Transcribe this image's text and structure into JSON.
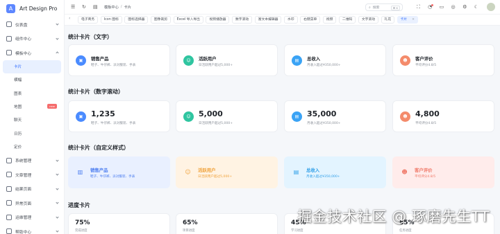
{
  "brand": {
    "name": "Art Design Pro",
    "logo_icon": "A"
  },
  "sidebar": {
    "items": [
      {
        "label": "仪表盘",
        "icon": "dashboard-icon",
        "expanded": false
      },
      {
        "label": "组件中心",
        "icon": "components-icon",
        "expanded": false
      },
      {
        "label": "模板中心",
        "icon": "template-icon",
        "expanded": true
      }
    ],
    "template_children": [
      {
        "label": "卡片",
        "active": true
      },
      {
        "label": "横幅"
      },
      {
        "label": "图表"
      },
      {
        "label": "地图",
        "badge": "new"
      },
      {
        "label": "聊天"
      },
      {
        "label": "日历"
      },
      {
        "label": "定价"
      }
    ],
    "more_items": [
      {
        "label": "系统管理",
        "icon": "system-icon"
      },
      {
        "label": "文章管理",
        "icon": "article-icon"
      },
      {
        "label": "结果页面",
        "icon": "result-icon"
      },
      {
        "label": "异常页面",
        "icon": "error-page-icon"
      },
      {
        "label": "运维管理",
        "icon": "ops-icon"
      },
      {
        "label": "帮助中心",
        "icon": "help-icon"
      }
    ]
  },
  "header": {
    "breadcrumb": [
      "模板中心",
      "卡片"
    ],
    "search_placeholder": "搜索",
    "search_shortcut": "⌘ K"
  },
  "tabs": [
    {
      "label": "电子商务"
    },
    {
      "label": "Icon 图标"
    },
    {
      "label": "图标选择器"
    },
    {
      "label": "图像裁剪"
    },
    {
      "label": "Excel 导入导出"
    },
    {
      "label": "视频播放器"
    },
    {
      "label": "数字滚动"
    },
    {
      "label": "富文本编辑器"
    },
    {
      "label": "水印"
    },
    {
      "label": "右键菜单"
    },
    {
      "label": "视频"
    },
    {
      "label": "二维码"
    },
    {
      "label": "文字滚动"
    },
    {
      "label": "礼花"
    },
    {
      "label": "卡片",
      "active": true
    }
  ],
  "sections": {
    "text_cards_title": "统计卡片（文字）",
    "number_cards_title": "统计卡片（数字滚动）",
    "custom_cards_title": "统计卡片（自定义样式）",
    "progress_cards_title": "进度卡片"
  },
  "text_cards": [
    {
      "title": "销售产品",
      "desc": "鞋子、牛仔裤、派对服装、手表",
      "icon": "box-icon",
      "color": "#4a8bff"
    },
    {
      "title": "活跃用户",
      "desc": "日活跃用户超过5,000+",
      "icon": "users-icon",
      "color": "#2fc5a0"
    },
    {
      "title": "总收入",
      "desc": "月收入超过¥350,000+",
      "icon": "wallet-icon",
      "color": "#3aa3f5"
    },
    {
      "title": "客户评价",
      "desc": "平均评分4.8/5",
      "icon": "smile-icon",
      "color": "#f48b6b"
    }
  ],
  "number_cards": [
    {
      "value": "1,235",
      "desc": "鞋子、牛仔裤、派对服装、手表"
    },
    {
      "value": "5,000",
      "desc": "日活跃用户超过5,000+"
    },
    {
      "value": "35,000",
      "desc": "月收入超过¥350,000+"
    },
    {
      "value": "4,800",
      "desc": "平均评分4.8/5"
    }
  ],
  "custom_cards": [
    {
      "title": "销售产品",
      "desc": "鞋子、牛仔裤、派对服装、手表",
      "accent": "#4a7cf0"
    },
    {
      "title": "活跃用户",
      "desc": "日活跃用户超过5,000+",
      "accent": "#f0a23a"
    },
    {
      "title": "总收入",
      "desc": "月收入超过¥350,000+",
      "accent": "#2f9fe8"
    },
    {
      "title": "客户评价",
      "desc": "平均评分4.8/5",
      "accent": "#f07a6a"
    }
  ],
  "progress_cards": [
    {
      "value": "75%",
      "label": "完成进度"
    },
    {
      "value": "65%",
      "label": "项目进度"
    },
    {
      "value": "45%",
      "label": "学习进度"
    },
    {
      "value": "85%",
      "label": "任务进度"
    }
  ],
  "watermark": "掘金技术社区 @ 琢磨先生TT"
}
